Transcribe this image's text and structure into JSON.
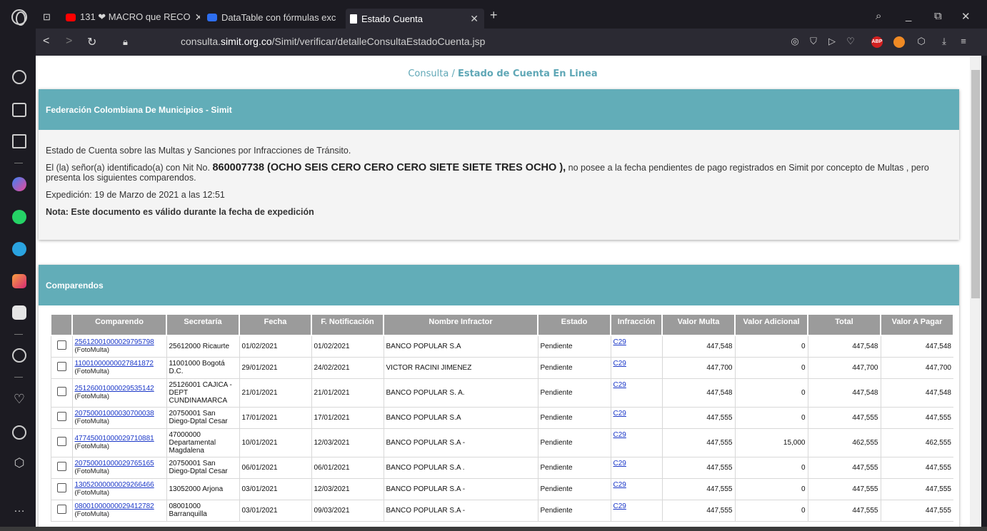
{
  "browser": {
    "tabs": [
      {
        "label": "131 ❤ MACRO que RECO",
        "icon": "youtube-icon",
        "color": "#ff0000"
      },
      {
        "label": "DataTable con fórmulas exc",
        "icon": "uipath-icon",
        "color": "#2d6ef0"
      },
      {
        "label": "Estado Cuenta",
        "icon": "document-icon",
        "color": "#ffffff"
      }
    ],
    "new_tab": "+",
    "url_prefix": "consulta.",
    "url_domain": "simit.org.co",
    "url_path": "/Simit/verificar/detalleConsultaEstadoCuenta.jsp"
  },
  "page": {
    "breadcrumb_a": "Consulta / ",
    "breadcrumb_b": "Estado de Cuenta En Linea",
    "federation_title": "Federación Colombiana De Municipios - Simit",
    "summary_line": "Estado de Cuenta sobre las Multas y Sanciones por Infracciones de Tránsito.",
    "person_pre": "El (la) señor(a) identificado(a) con Nit No.",
    "person_id": "860007738 (OCHO SEIS CERO CERO CERO SIETE SIETE TRES OCHO ),",
    "person_post": "no posee a la fecha pendientes de pago registrados en Simit por concepto de Multas , pero presenta los siguientes comparendos.",
    "expedicion": "Expedición: 19 de Marzo de 2021 a las 12:51",
    "nota": "Nota: Este documento es válido durante la fecha de expedición",
    "comparendos_title": "Comparendos"
  },
  "table": {
    "headers": [
      "Comparendo",
      "Secretaría",
      "Fecha",
      "F. Notificación",
      "Nombre Infractor",
      "Estado",
      "Infracción",
      "Valor Multa",
      "Valor Adicional",
      "Total",
      "Valor A Pagar"
    ],
    "rows": [
      {
        "comp": "25612001000029795798",
        "tipo": "(FotoMulta)",
        "sec": "25612000 Ricaurte",
        "fecha": "01/02/2021",
        "notif": "01/02/2021",
        "nombre": "BANCO POPULAR S.A",
        "estado": "Pendiente",
        "infr": "C29",
        "multa": "447,548",
        "adic": "0",
        "total": "447,548",
        "pagar": "447,548"
      },
      {
        "comp": "11001000000027841872",
        "tipo": "(FotoMulta)",
        "sec": "11001000 Bogotá D.C.",
        "fecha": "29/01/2021",
        "notif": "24/02/2021",
        "nombre": "VICTOR RACINI JIMENEZ",
        "estado": "Pendiente",
        "infr": "C29",
        "multa": "447,700",
        "adic": "0",
        "total": "447,700",
        "pagar": "447,700"
      },
      {
        "comp": "25126001000029535142",
        "tipo": "(FotoMulta)",
        "sec": "25126001 CAJICA - DEPT CUNDINAMARCA",
        "fecha": "21/01/2021",
        "notif": "21/01/2021",
        "nombre": "BANCO POPULAR S. A.",
        "estado": "Pendiente",
        "infr": "C29",
        "multa": "447,548",
        "adic": "0",
        "total": "447,548",
        "pagar": "447,548"
      },
      {
        "comp": "20750001000030700038",
        "tipo": "(FotoMulta)",
        "sec": "20750001 San Diego-Dptal Cesar",
        "fecha": "17/01/2021",
        "notif": "17/01/2021",
        "nombre": "BANCO POPULAR S.A",
        "estado": "Pendiente",
        "infr": "C29",
        "multa": "447,555",
        "adic": "0",
        "total": "447,555",
        "pagar": "447,555"
      },
      {
        "comp": "47745001000029710881",
        "tipo": "(FotoMulta)",
        "sec": "47000000 Departamental Magdalena",
        "fecha": "10/01/2021",
        "notif": "12/03/2021",
        "nombre": "BANCO POPULAR S.A -",
        "estado": "Pendiente",
        "infr": "C29",
        "multa": "447,555",
        "adic": "15,000",
        "total": "462,555",
        "pagar": "462,555"
      },
      {
        "comp": "20750001000029765165",
        "tipo": "(FotoMulta)",
        "sec": "20750001 San Diego-Dptal Cesar",
        "fecha": "06/01/2021",
        "notif": "06/01/2021",
        "nombre": "BANCO POPULAR S.A .",
        "estado": "Pendiente",
        "infr": "C29",
        "multa": "447,555",
        "adic": "0",
        "total": "447,555",
        "pagar": "447,555"
      },
      {
        "comp": "13052000000029266466",
        "tipo": "(FotoMulta)",
        "sec": "13052000 Arjona",
        "fecha": "03/01/2021",
        "notif": "12/03/2021",
        "nombre": "BANCO POPULAR S.A -",
        "estado": "Pendiente",
        "infr": "C29",
        "multa": "447,555",
        "adic": "0",
        "total": "447,555",
        "pagar": "447,555"
      },
      {
        "comp": "08001000000029412782",
        "tipo": "(FotoMulta)",
        "sec": "08001000 Barranquilla",
        "fecha": "03/01/2021",
        "notif": "09/03/2021",
        "nombre": "BANCO POPULAR S.A -",
        "estado": "Pendiente",
        "infr": "C29",
        "multa": "447,555",
        "adic": "0",
        "total": "447,555",
        "pagar": "447,555"
      }
    ]
  }
}
